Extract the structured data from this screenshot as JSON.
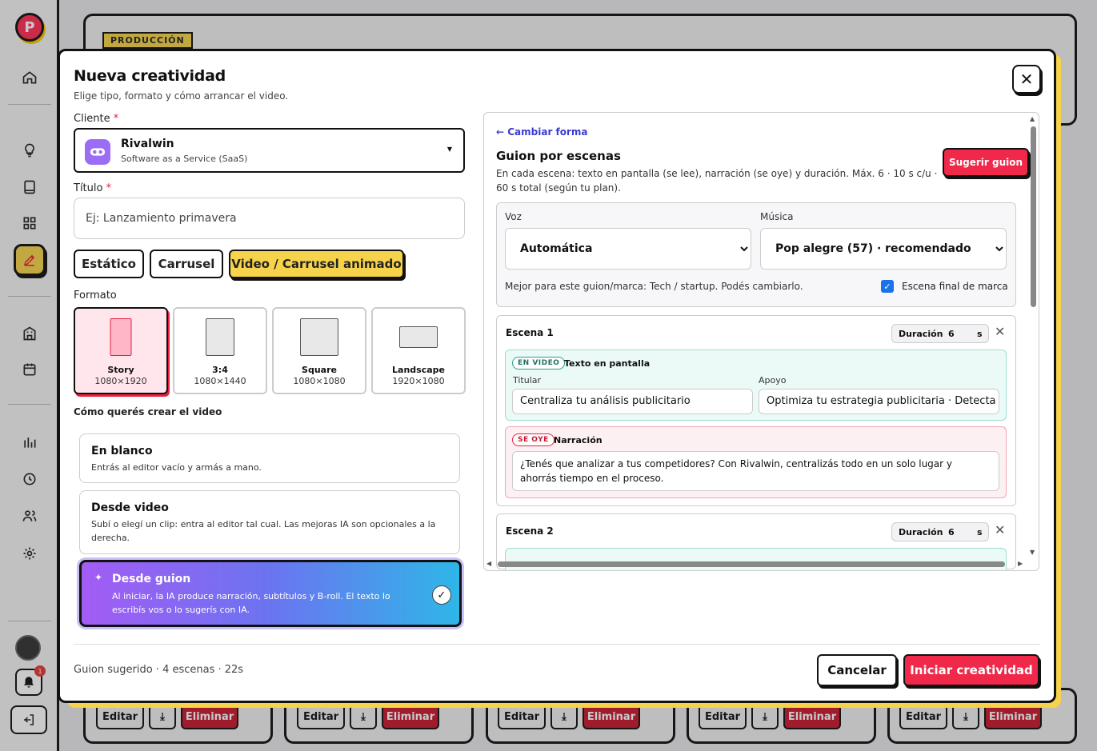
{
  "background": {
    "logo": "P",
    "tag": "PRODUCCIÓN",
    "notifications": "1",
    "card_actions": {
      "edit": "Editar",
      "delete": "Eliminar"
    }
  },
  "modal": {
    "title": "Nueva creatividad",
    "subtitle": "Elige tipo, formato y cómo arrancar el video.",
    "client_label": "Cliente",
    "required_mark": "*",
    "client": {
      "name": "Rivalwin",
      "description": "Software as a Service (SaaS)"
    },
    "title_label": "Título",
    "title_placeholder": "Ej: Lanzamiento primavera",
    "types": [
      "Estático",
      "Carrusel",
      "Video / Carrusel animado"
    ],
    "active_type": "Video / Carrusel animado",
    "format_label": "Formato",
    "formats": [
      {
        "name": "Story",
        "dims": "1080×1920"
      },
      {
        "name": "3:4",
        "dims": "1080×1440"
      },
      {
        "name": "Square",
        "dims": "1080×1080"
      },
      {
        "name": "Landscape",
        "dims": "1920×1080"
      }
    ],
    "active_format": "Story",
    "mode_label": "Cómo querés crear el video",
    "modes": [
      {
        "title": "En blanco",
        "desc": "Entrás al editor vacío y armás a mano."
      },
      {
        "title": "Desde video",
        "desc": "Subí o elegí un clip: entra al editor tal cual. Las mejoras IA son opcionales a la derecha."
      },
      {
        "title": "Desde guion",
        "desc": "Al iniciar, la IA produce narración, subtítulos y B-roll. El texto lo escribís vos o lo sugerís con IA."
      }
    ],
    "selected_mode": "Desde guion",
    "footer_info": "Guion sugerido · 4 escenas · 22s",
    "cancel": "Cancelar",
    "start": "Iniciar creatividad"
  },
  "script_panel": {
    "back_link": "← Cambiar forma",
    "title": "Guion por escenas",
    "description": "En cada escena: texto en pantalla (se lee), narración (se oye) y duración. Máx. 6 · 10 s c/u · 60 s total (según tu plan).",
    "suggest_button": "Sugerir guion",
    "voice_label": "Voz",
    "voice_value": "Automática",
    "music_label": "Música",
    "music_value": "Pop alegre (57) · recomendado",
    "music_hint": "Mejor para este guion/marca: Tech / startup. Podés cambiarlo.",
    "end_scene_label": "Escena final de marca",
    "end_scene_checked": true,
    "scenes": [
      {
        "title": "Escena 1",
        "duration_label": "Duración",
        "duration": "6",
        "unit": "s",
        "onscreen_tag": "EN VIDEO",
        "onscreen_title": "Texto en pantalla",
        "headline_label": "Titular",
        "headline": "Centraliza tu análisis publicitario",
        "support_label": "Apoyo",
        "support": "Optimiza tu estrategia publicitaria · Detecta ca",
        "voice_tag": "SE OYE",
        "voice_title": "Narración",
        "narration": "¿Tenés que analizar a tus competidores? Con Rivalwin, centralizás todo en un solo lugar y ahorrás tiempo en el proceso."
      },
      {
        "title": "Escena 2",
        "duration_label": "Duración",
        "duration": "6",
        "unit": "s"
      }
    ]
  },
  "colors": {
    "accent_red": "#f0284a",
    "accent_yellow": "#f6d34a",
    "link_blue": "#3b3bd0"
  }
}
